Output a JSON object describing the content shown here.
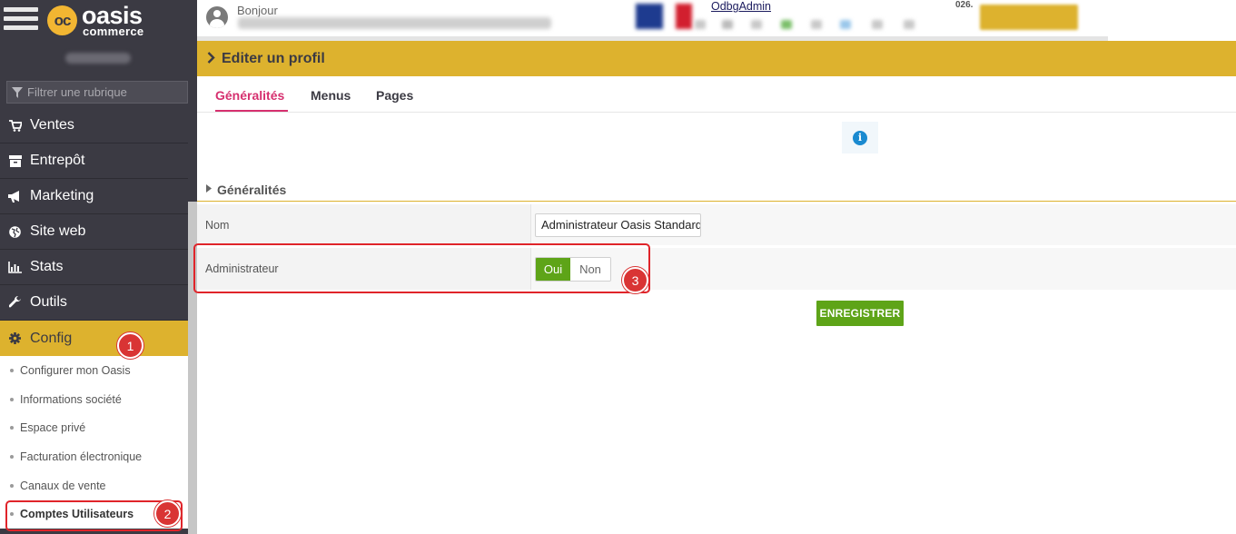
{
  "app": {
    "logo_line1": "oasis",
    "logo_line2": "commerce",
    "logo_mark": "oc"
  },
  "sidebar": {
    "filter_placeholder": "Filtrer une rubrique",
    "items": [
      {
        "label": "Ventes",
        "icon": "cart-icon"
      },
      {
        "label": "Entrepôt",
        "icon": "archive-icon"
      },
      {
        "label": "Marketing",
        "icon": "bullhorn-icon"
      },
      {
        "label": "Site web",
        "icon": "globe-icon"
      },
      {
        "label": "Stats",
        "icon": "bar-chart-icon"
      },
      {
        "label": "Outils",
        "icon": "wrench-icon"
      },
      {
        "label": "Config",
        "icon": "gear-icon"
      }
    ],
    "subitems": [
      {
        "label": "Configurer mon Oasis"
      },
      {
        "label": "Informations société"
      },
      {
        "label": "Espace privé"
      },
      {
        "label": "Facturation électronique"
      },
      {
        "label": "Canaux de vente"
      },
      {
        "label": "Comptes Utilisateurs"
      }
    ]
  },
  "topbar": {
    "greeting": "Bonjour",
    "admin_link": "OdbgAdmin",
    "code_text": "026."
  },
  "page": {
    "title": "Editer un profil",
    "tabs": [
      {
        "label": "Généralités"
      },
      {
        "label": "Menus"
      },
      {
        "label": "Pages"
      }
    ],
    "section_title": "Généralités",
    "fields": {
      "name_label": "Nom",
      "name_value": "Administrateur Oasis Standard",
      "admin_label": "Administrateur",
      "admin_yes": "Oui",
      "admin_no": "Non",
      "admin_selected": "Oui"
    },
    "save_label": "ENREGISTRER"
  },
  "annotations": {
    "badge1": "1",
    "badge2": "2",
    "badge3": "3"
  },
  "colors": {
    "sidebar_bg": "#3b3a43",
    "accent_gold": "#ddb22e",
    "tab_active": "#d6306f",
    "success_green": "#5ea418",
    "annotation_red": "#e0242a",
    "info_blue": "#1a8ad0"
  }
}
